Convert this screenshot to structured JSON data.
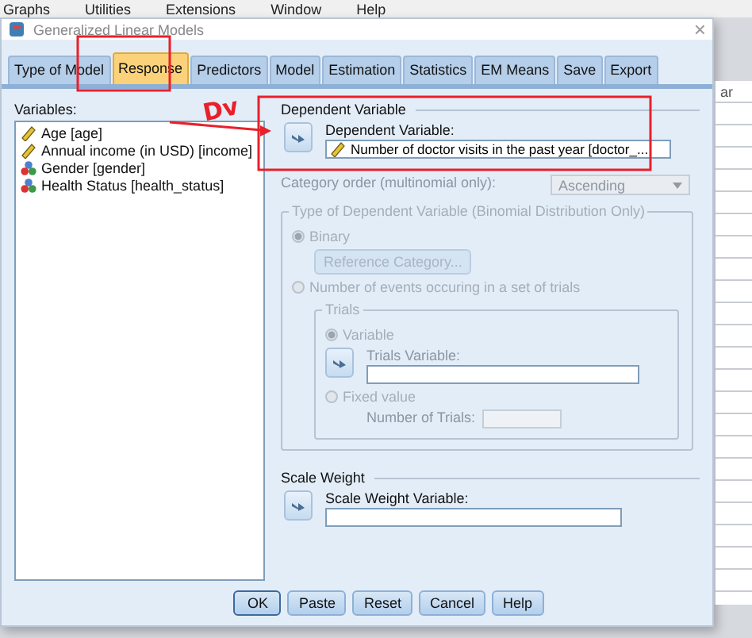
{
  "menu_bar": [
    "Graphs",
    "Utilities",
    "Extensions",
    "Window",
    "Help"
  ],
  "background": {
    "column_header_fragment": "ar"
  },
  "window": {
    "title": "Generalized Linear Models",
    "close": "×"
  },
  "tabs": [
    {
      "label": "Type of Model",
      "selected": false
    },
    {
      "label": "Response",
      "selected": true
    },
    {
      "label": "Predictors",
      "selected": false
    },
    {
      "label": "Model",
      "selected": false
    },
    {
      "label": "Estimation",
      "selected": false
    },
    {
      "label": "Statistics",
      "selected": false
    },
    {
      "label": "EM Means",
      "selected": false
    },
    {
      "label": "Save",
      "selected": false
    },
    {
      "label": "Export",
      "selected": false
    }
  ],
  "variables": {
    "label": "Variables:",
    "items": [
      {
        "name": "Age [age]",
        "kind": "scale"
      },
      {
        "name": "Annual income (in USD) [income]",
        "kind": "scale"
      },
      {
        "name": "Gender [gender]",
        "kind": "nominal"
      },
      {
        "name": "Health Status [health_status]",
        "kind": "nominal"
      }
    ]
  },
  "dependent": {
    "group": "Dependent Variable",
    "label": "Dependent Variable:",
    "value": "Number of doctor visits in the past year  [doctor_...",
    "category_order_label": "Category order (multinomial only):",
    "category_order": "Ascending",
    "category_order_disabled": true
  },
  "type_group": {
    "title": "Type of Dependent Variable (Binomial Distribution Only)",
    "disabled": true,
    "binary": {
      "label": "Binary",
      "selected": true
    },
    "reference_button": "Reference Category...",
    "events": {
      "label": "Number of events occuring in a set of trials",
      "selected": false
    },
    "trials": {
      "title": "Trials",
      "variable": {
        "label": "Variable",
        "selected": true
      },
      "trials_variable_label": "Trials Variable:",
      "fixed": {
        "label": "Fixed value",
        "selected": false
      },
      "number_label": "Number of Trials:"
    }
  },
  "scale_weight": {
    "group": "Scale Weight",
    "label": "Scale Weight Variable:"
  },
  "buttons": [
    {
      "label": "OK",
      "default": true
    },
    {
      "label": "Paste",
      "default": false
    },
    {
      "label": "Reset",
      "default": false
    },
    {
      "label": "Cancel",
      "default": false
    },
    {
      "label": "Help",
      "default": false
    }
  ],
  "annotations": {
    "handwritten": "Dv"
  }
}
